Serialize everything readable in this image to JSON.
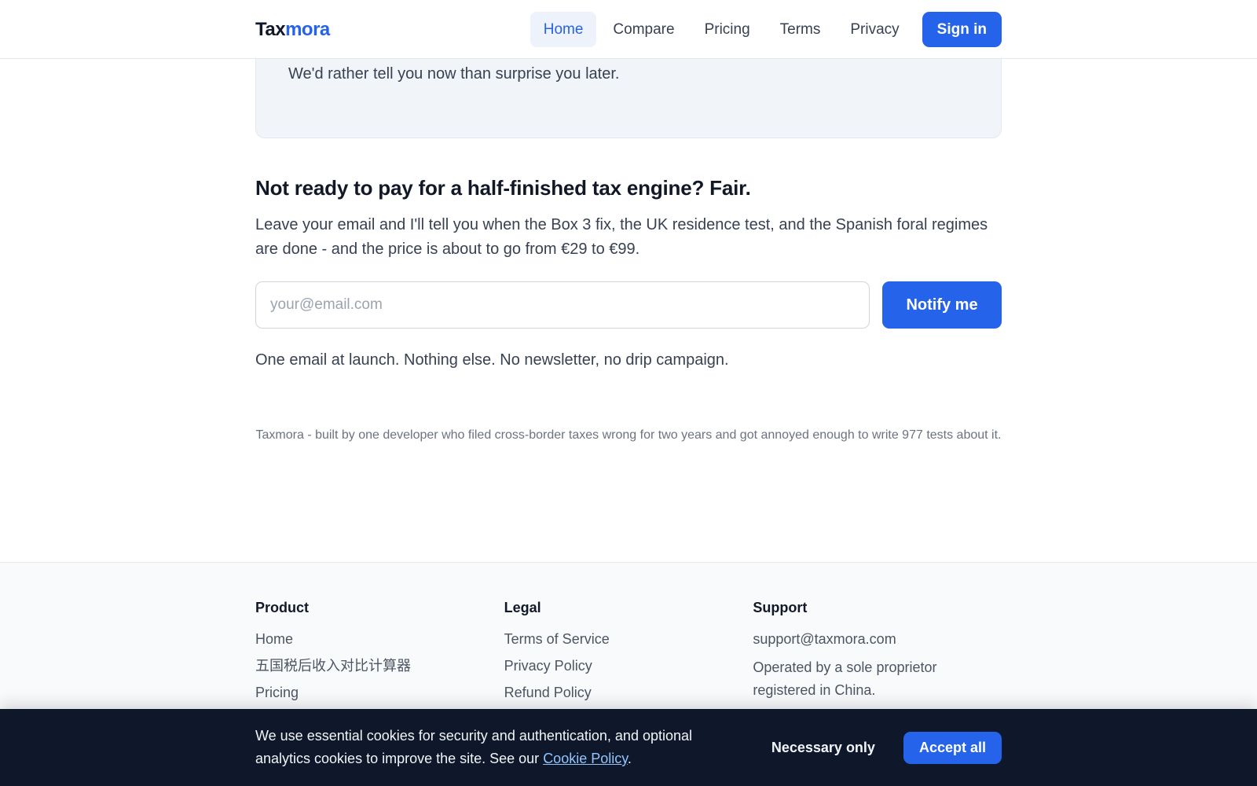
{
  "header": {
    "logo_part1": "Tax",
    "logo_part2": "mora",
    "nav": [
      "Home",
      "Compare",
      "Pricing",
      "Terms",
      "Privacy"
    ],
    "active_nav": "Home",
    "signin_label": "Sign in"
  },
  "info_card": {
    "text": "We'd rather tell you now than surprise you later."
  },
  "notify": {
    "heading": "Not ready to pay for a half-finished tax engine? Fair.",
    "lead": "Leave your email and I'll tell you when the Box 3 fix, the UK residence test, and the Spanish foral regimes are done - and the price is about to go from €29 to €99.",
    "email_placeholder": "your@email.com",
    "button_label": "Notify me",
    "fineprint": "One email at launch. Nothing else. No newsletter, no drip campaign."
  },
  "credit": "Taxmora - built by one developer who filed cross-border taxes wrong for two years and got annoyed enough to write 977 tests about it.",
  "footer": {
    "product": {
      "title": "Product",
      "items": [
        "Home",
        "五国税后收入对比计算器",
        "Pricing"
      ]
    },
    "legal": {
      "title": "Legal",
      "items": [
        "Terms of Service",
        "Privacy Policy",
        "Refund Policy"
      ]
    },
    "support": {
      "title": "Support",
      "email": "support@taxmora.com",
      "note": "Operated by a sole proprietor registered in China."
    }
  },
  "cookie": {
    "text_before": "We use essential cookies for security and authentication, and optional analytics cookies to improve the site. See our ",
    "link_label": "Cookie Policy",
    "text_after": ".",
    "necessary_label": "Necessary only",
    "accept_label": "Accept all"
  },
  "colors": {
    "accent": "#2563eb",
    "banner_bg": "#0f172a"
  }
}
